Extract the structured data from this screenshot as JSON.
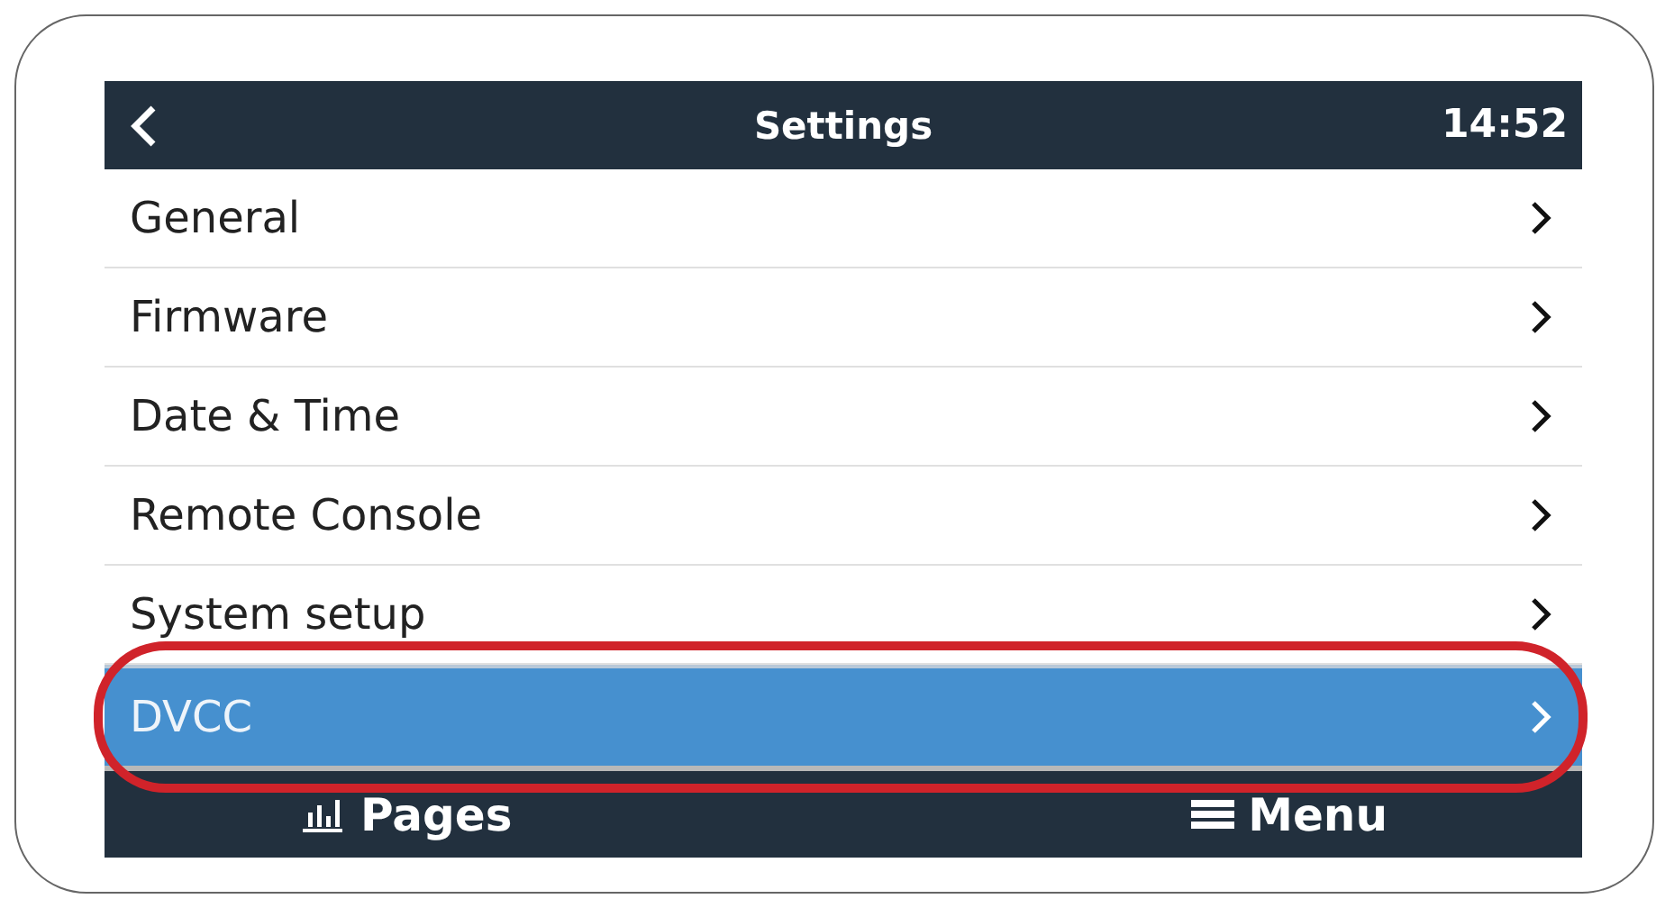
{
  "header": {
    "title": "Settings",
    "time": "14:52"
  },
  "items": [
    {
      "label": "General",
      "selected": false
    },
    {
      "label": "Firmware",
      "selected": false
    },
    {
      "label": "Date & Time",
      "selected": false
    },
    {
      "label": "Remote Console",
      "selected": false
    },
    {
      "label": "System setup",
      "selected": false
    },
    {
      "label": "DVCC",
      "selected": true,
      "highlighted": true
    }
  ],
  "footer": {
    "pages": "Pages",
    "menu": "Menu"
  }
}
